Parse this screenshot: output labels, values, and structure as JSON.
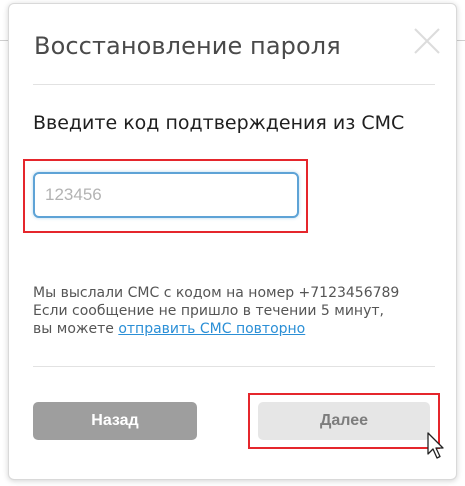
{
  "dialog": {
    "title": "Восстановление пароля",
    "subtitle": "Введите код подтверждения из СМС",
    "code_input": {
      "value": "",
      "placeholder": "123456"
    },
    "info": {
      "line1": "Мы выслали СМС с кодом на номер +7123456789",
      "line2": "Если сообщение не пришло в течении 5 минут,",
      "line3_prefix": "вы можете ",
      "resend_link": "отправить СМС повторно"
    },
    "buttons": {
      "back": "Назад",
      "next": "Далее"
    }
  },
  "colors": {
    "highlight": "#e5262c",
    "link": "#2b8fd6",
    "input_focus": "#5ea3d6",
    "back_button": "#9e9e9e",
    "next_button_disabled": "#e6e6e6"
  },
  "icons": {
    "close": "close-icon",
    "cursor": "mouse-pointer-icon"
  }
}
